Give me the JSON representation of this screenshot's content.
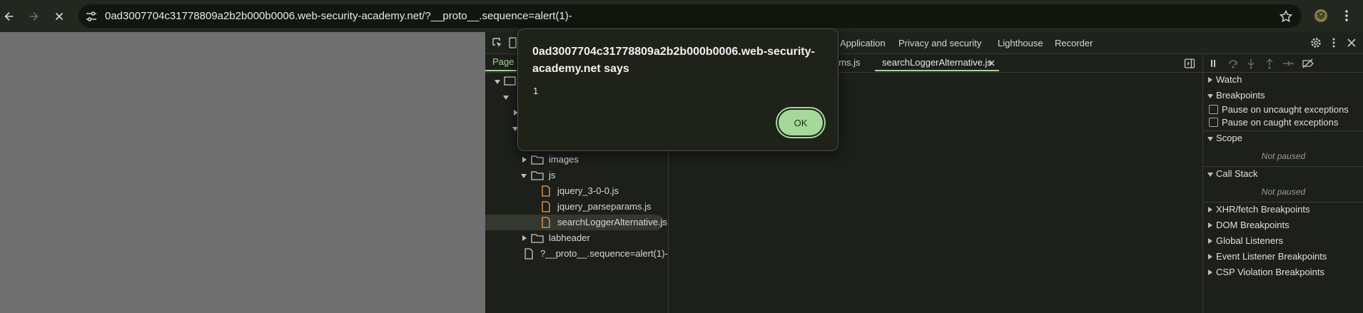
{
  "browser": {
    "url": "0ad3007704c31778809a2b2b000b0006.web-security-academy.net/?__proto__.sequence=alert(1)-"
  },
  "icons": {
    "back": "arrow-left-icon",
    "forward": "arrow-right-icon",
    "stop": "close-icon",
    "site_info": "tune-icon",
    "bookmark": "star-icon",
    "extension": "extension-icon",
    "menu": "kebab-icon"
  },
  "colors": {
    "accent": "#a9d49a",
    "ok_button": "#a5d89a",
    "file_js": "#e8a060"
  },
  "devtools": {
    "main_tabs": [
      "Application",
      "Privacy and security",
      "Lighthouse",
      "Recorder"
    ],
    "sources": {
      "page_tab": "Page",
      "open_files": [
        "ams.js",
        "searchLoggerAlternative.js"
      ],
      "tree": [
        {
          "label": "images",
          "type": "folder",
          "expanded": false
        },
        {
          "label": "js",
          "type": "folder",
          "expanded": true
        },
        {
          "label": "jquery_3-0-0.js",
          "type": "file"
        },
        {
          "label": "jquery_parseparams.js",
          "type": "file"
        },
        {
          "label": "searchLoggerAlternative.js",
          "type": "file",
          "selected": true
        },
        {
          "label": "labheader",
          "type": "folder",
          "expanded": false
        },
        {
          "label": "?__proto__.sequence=alert(1)-",
          "type": "document"
        }
      ]
    },
    "debugger": {
      "watch": "Watch",
      "breakpoints": "Breakpoints",
      "pause_uncaught": "Pause on uncaught exceptions",
      "pause_caught": "Pause on caught exceptions",
      "scope": "Scope",
      "scope_status": "Not paused",
      "call_stack": "Call Stack",
      "call_stack_status": "Not paused",
      "xhr": "XHR/fetch Breakpoints",
      "dom": "DOM Breakpoints",
      "global": "Global Listeners",
      "event": "Event Listener Breakpoints",
      "csp": "CSP Violation Breakpoints"
    }
  },
  "dialog": {
    "title": "0ad3007704c31778809a2b2b000b0006.web-security-academy.net says",
    "message": "1",
    "ok": "OK"
  }
}
